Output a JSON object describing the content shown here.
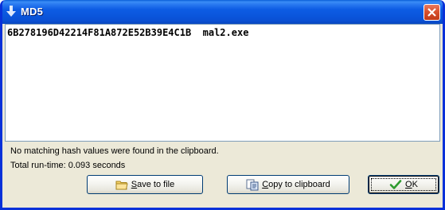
{
  "window": {
    "title": "MD5",
    "title_icon": "down-arrow-icon",
    "close_icon": "close-icon"
  },
  "hash_area": {
    "line": "6B278196D42214F81A872E52B39E4C1B  mal2.exe"
  },
  "status": {
    "message": "No matching hash values were found in the clipboard.",
    "runtime": "Total run-time: 0.093 seconds"
  },
  "buttons": {
    "save": {
      "label_pre": "",
      "label_u": "S",
      "label_post": "ave to file",
      "icon": "folder-icon"
    },
    "copy": {
      "label_pre": "",
      "label_u": "C",
      "label_post": "opy to clipboard",
      "icon": "clipboard-icon"
    },
    "ok": {
      "label_pre": "",
      "label_u": "O",
      "label_post": "K",
      "icon": "checkmark-icon"
    }
  },
  "colors": {
    "titlebar": "#0a55db",
    "window_bg": "#ece9d8",
    "ok_check": "#2e9b2e"
  }
}
